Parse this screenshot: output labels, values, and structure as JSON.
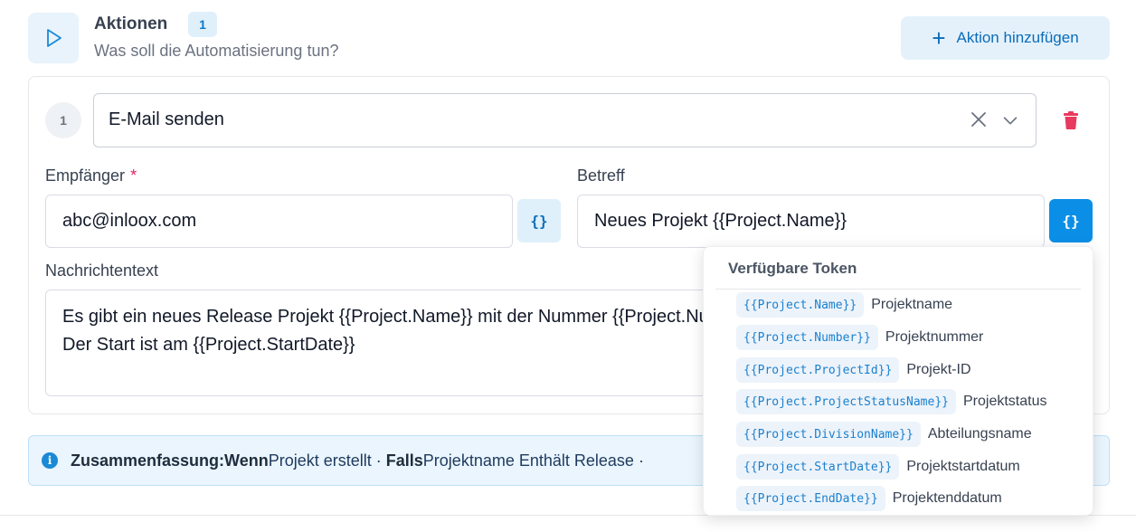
{
  "header": {
    "title": "Aktionen",
    "count": "1",
    "subtitle": "Was soll die Automatisierung tun?",
    "add_button_label": "Aktion hinzufügen"
  },
  "action": {
    "step_number": "1",
    "selected_action": "E-Mail senden"
  },
  "fields": {
    "recipient_label": "Empfänger",
    "recipient_required_marker": "*",
    "recipient_value": "abc@inloox.com",
    "subject_label": "Betreff",
    "subject_value": "Neues Projekt {{Project.Name}}",
    "message_label": "Nachrichtentext",
    "message_line1": "Es gibt ein neues Release Projekt {{Project.Name}} mit der Nummer {{Project.Number}}.",
    "message_line2": "Der Start ist am {{Project.StartDate}}",
    "token_button_label": "{}"
  },
  "summary": {
    "prefix": "Zusammenfassung:",
    "when_label": "Wenn",
    "when_value": "Projekt erstellt",
    "separator": "·",
    "if_label": "Falls",
    "if_value": "Projektname Enthält Release",
    "tail": "·"
  },
  "token_popover": {
    "title": "Verfügbare Token",
    "tokens": [
      {
        "token": "{{Project.Name}}",
        "label": "Projektname"
      },
      {
        "token": "{{Project.Number}}",
        "label": "Projektnummer"
      },
      {
        "token": "{{Project.ProjectId}}",
        "label": "Projekt-ID"
      },
      {
        "token": "{{Project.ProjectStatusName}}",
        "label": "Projektstatus"
      },
      {
        "token": "{{Project.DivisionName}}",
        "label": "Abteilungsname"
      },
      {
        "token": "{{Project.StartDate}}",
        "label": "Projektstartdatum"
      },
      {
        "token": "{{Project.EndDate}}",
        "label": "Projektenddatum"
      }
    ]
  },
  "colors": {
    "accent": "#0b8fe6",
    "danger": "#e0245e"
  }
}
